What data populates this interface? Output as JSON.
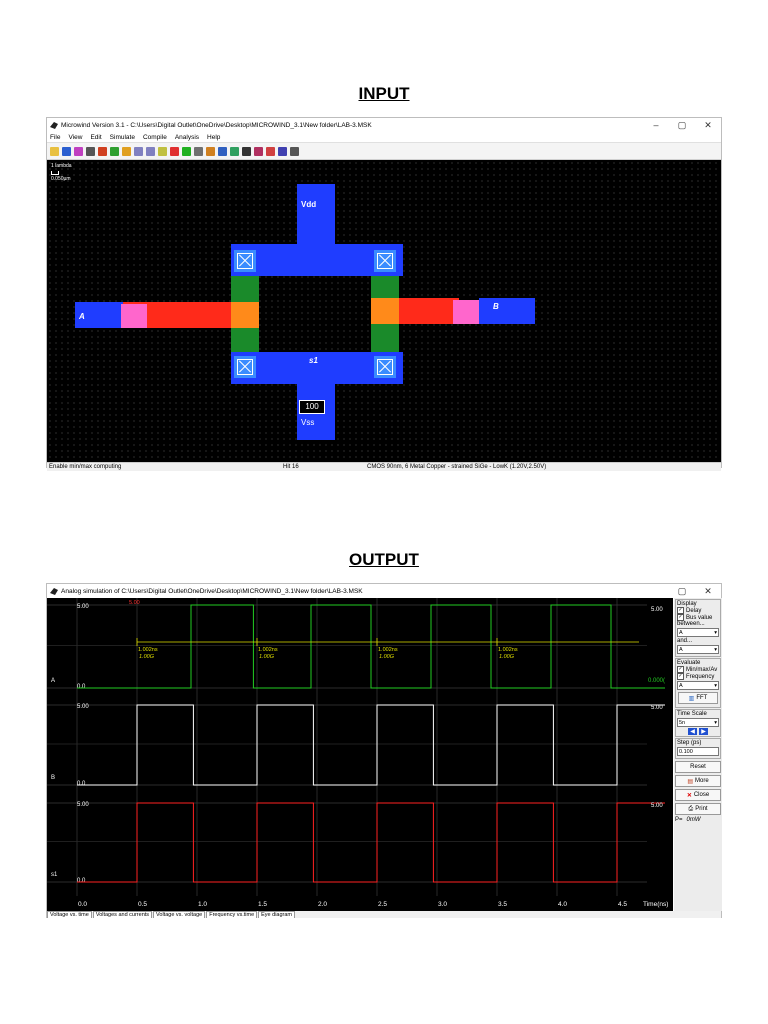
{
  "input_title": "INPUT",
  "output_title": "OUTPUT",
  "editor": {
    "title": "Microwind Version 3.1 - C:\\Users\\Digital Outlet\\OneDrive\\Desktop\\MICROWIND_3.1\\New folder\\LAB-3.MSK",
    "menu": [
      "File",
      "View",
      "Edit",
      "Simulate",
      "Compile",
      "Analysis",
      "Help"
    ],
    "scale_label": "1 lambda",
    "scale_value": "0.050µm",
    "labels": {
      "vdd": "Vdd",
      "a": "A",
      "b": "B",
      "s1": "s1",
      "vss": "Vss",
      "cap": "100"
    },
    "status": {
      "left": "Enable min/max computing",
      "mid": "Hit 16",
      "right": "CMOS 90nm, 6 Metal Copper - strained SiGe - LowK (1.20V,2.50V)"
    },
    "colors": {
      "metal": "#1f3dff",
      "poly": "#ff2a1a",
      "diff": "#1a8a2a",
      "gate": "#ff8a1a",
      "contact": "#3a8cff",
      "via": "#ff66cc"
    }
  },
  "sim": {
    "title": "Analog simulation of C:\\Users\\Digital Outlet\\OneDrive\\Desktop\\MICROWIND_3.1\\New folder\\LAB-3.MSK",
    "ticks": [
      "0.0",
      "0.5",
      "1.0",
      "1.5",
      "2.0",
      "2.5",
      "3.0",
      "3.5",
      "4.0",
      "4.5"
    ],
    "time_label": "Time(ns)",
    "signals": [
      "A",
      "B",
      "s1"
    ],
    "vmax": "5.00",
    "vmin": "0.0",
    "top_marker": "5.00",
    "delay_ns": "1.002ns",
    "delay_ghz": "1.00G",
    "right_values": [
      "5.00",
      "0.000(",
      "5.00",
      "5.00"
    ],
    "panel": {
      "display": "Display",
      "delay": "Delay",
      "bus_value": "Bus value",
      "between": "between...",
      "sel1": "A",
      "and": "and...",
      "sel2": "A",
      "evaluate": "Evaluate",
      "minmax": "Min/max/Av",
      "frequency": "Frequency",
      "sel3": "A",
      "fft": "FFT",
      "time_scale": "Time Scale",
      "ts_value": "5n",
      "step": "Step (ps)",
      "step_value": "0.100",
      "reset": "Reset",
      "more": "More",
      "close": "Close",
      "print": "Print",
      "power": "P=",
      "power_value": "0mW"
    },
    "tabs": [
      "Voltage vs. time",
      "Voltages and currents",
      "Voltage vs. voltage",
      "Frequency vs.time",
      "Eye diagram"
    ],
    "colors": {
      "a": "#22cc22",
      "b": "#ffffff",
      "s1": "#ff2222",
      "grid": "#3a3a3a",
      "marker": "#e0e000"
    }
  },
  "chart_data": {
    "type": "line",
    "x_unit": "ns",
    "xlim": [
      0,
      4.9
    ],
    "ylim": [
      0,
      5
    ],
    "series": [
      {
        "name": "A",
        "x": [
          0,
          0.95,
          0.95,
          1.47,
          1.47,
          1.95,
          1.95,
          2.45,
          2.45,
          2.95,
          2.95,
          3.45,
          3.45,
          3.95,
          3.95,
          4.45,
          4.45,
          4.9
        ],
        "y": [
          0,
          0,
          5,
          5,
          0,
          0,
          5,
          5,
          0,
          0,
          5,
          5,
          0,
          0,
          5,
          5,
          0,
          0
        ]
      },
      {
        "name": "B",
        "x": [
          0,
          0.5,
          0.5,
          0.97,
          0.97,
          1.5,
          1.5,
          1.97,
          1.97,
          2.5,
          2.5,
          2.97,
          2.97,
          3.5,
          3.5,
          3.97,
          3.97,
          4.5,
          4.5,
          4.9
        ],
        "y": [
          0,
          0,
          5,
          5,
          0,
          0,
          5,
          5,
          0,
          0,
          5,
          5,
          0,
          0,
          5,
          5,
          0,
          0,
          5,
          5
        ]
      },
      {
        "name": "s1",
        "x": [
          0,
          0.5,
          0.5,
          0.97,
          0.97,
          1.5,
          1.5,
          1.97,
          1.97,
          2.5,
          2.5,
          2.97,
          2.97,
          3.5,
          3.5,
          3.97,
          3.97,
          4.5,
          4.5,
          4.9
        ],
        "y": [
          0,
          0,
          5,
          5,
          0,
          0,
          5,
          5,
          0,
          0,
          5,
          5,
          0,
          0,
          5,
          5,
          0,
          0,
          5,
          5
        ]
      }
    ]
  }
}
